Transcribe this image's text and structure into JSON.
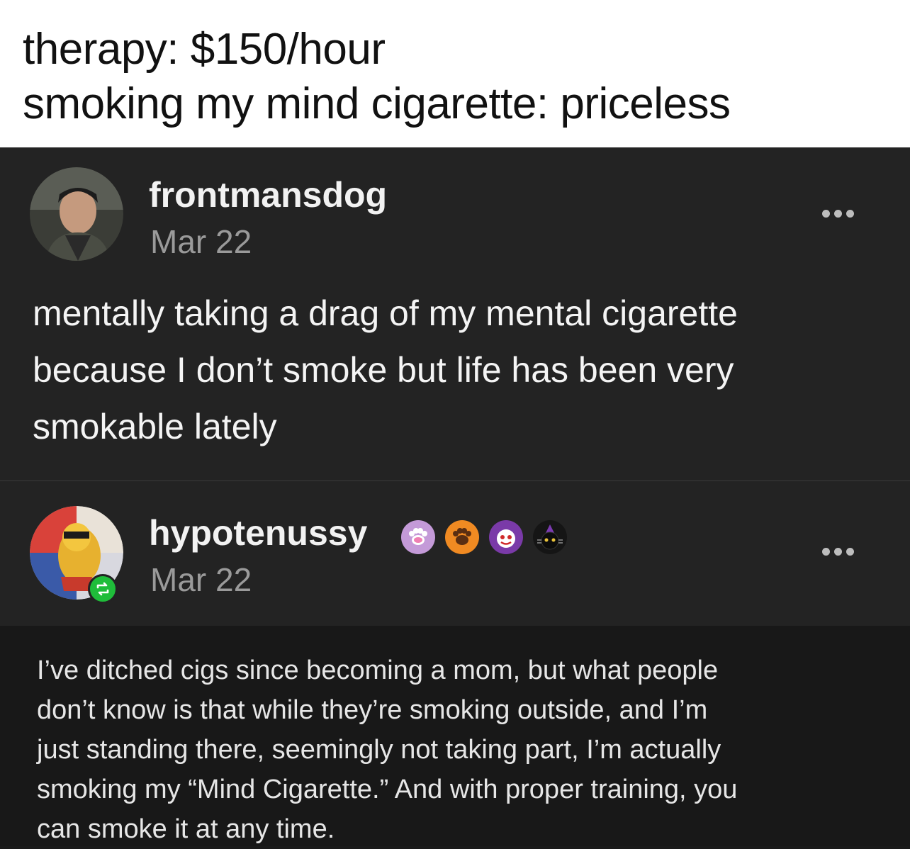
{
  "caption": {
    "line1": "therapy: $150/hour",
    "line2": "smoking my mind cigarette: priceless"
  },
  "post1": {
    "username": "frontmansdog",
    "date": "Mar 22",
    "more_icon": "more-horizontal-icon",
    "body_lines": [
      "mentally taking a drag of my mental cigarette",
      "because I don’t smoke but life has been very",
      "smokable lately"
    ]
  },
  "post2": {
    "username": "hypotenussy",
    "date": "Mar 22",
    "more_icon": "more-horizontal-icon",
    "badges": [
      "pink-paw-badge-icon",
      "orange-paw-badge-icon",
      "clown-face-badge-icon",
      "witch-cat-badge-icon"
    ],
    "reblog_icon": "reblog-icon",
    "reblog_color": "#1fbd3a"
  },
  "quote": {
    "lines": [
      "I’ve ditched cigs since becoming a mom, but what people",
      "don’t know is that while they’re smoking outside, and I’m",
      "just standing there, seemingly not taking part, I’m actually",
      "smoking my “Mind Cigarette.” And with proper training, you",
      "can smoke it at any time."
    ]
  }
}
